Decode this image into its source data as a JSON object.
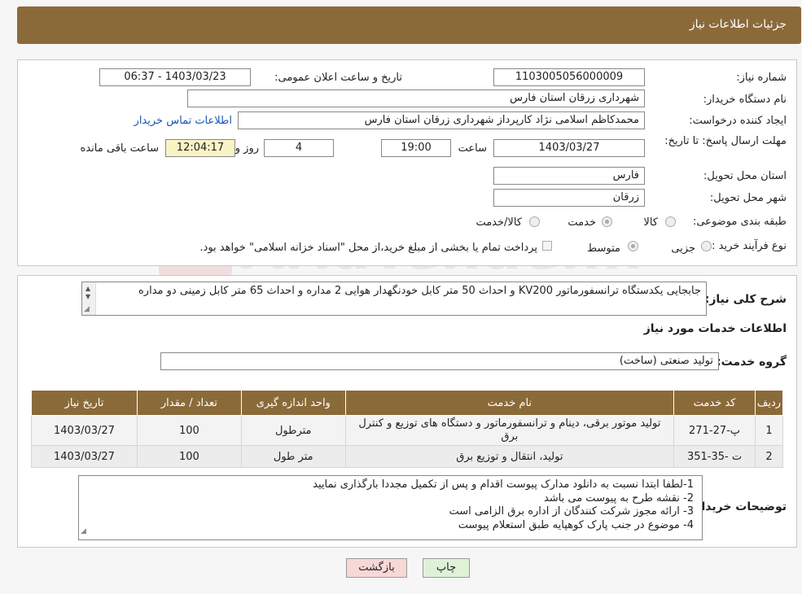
{
  "header": {
    "title": "جزئیات اطلاعات نیاز"
  },
  "form": {
    "need_number_label": "شماره نیاز:",
    "need_number": "1103005056000009",
    "announce_label": "تاریخ و ساعت اعلان عمومی:",
    "announce_value": "1403/03/23 - 06:37",
    "buyer_label": "نام دستگاه خریدار:",
    "buyer_value": "شهرداری زرقان استان فارس",
    "creator_label": "ایجاد کننده درخواست:",
    "creator_value": "محمدکاظم اسلامی نژاد کارپرداز شهرداری زرقان استان فارس",
    "contact_link": "اطلاعات تماس خریدار",
    "deadline_label": "مهلت ارسال پاسخ: تا تاریخ:",
    "deadline_date": "1403/03/27",
    "time_label": "ساعت",
    "deadline_time": "19:00",
    "days_value": "4",
    "days_label": "روز و",
    "remaining_time": "12:04:17",
    "remaining_label": "ساعت باقی مانده",
    "province_label": "استان محل تحویل:",
    "province_value": "فارس",
    "city_label": "شهر محل تحویل:",
    "city_value": "زرقان",
    "category_label": "طبقه بندی موضوعی:",
    "category_options": [
      "کالا",
      "خدمت",
      "کالا/خدمت"
    ],
    "category_selected": "خدمت",
    "process_label": "نوع فرآیند خرید :",
    "process_options": [
      "جزیی",
      "متوسط"
    ],
    "process_selected": "متوسط",
    "payment_note": "پرداخت تمام یا بخشی از مبلغ خرید،از محل \"اسناد خزانه اسلامی\" خواهد بود."
  },
  "summary": {
    "label": "شرح کلی نیاز:",
    "text": "جابجایی یکدستگاه ترانسفورماتور KV200 و احداث 50 متر کابل خودنگهدار هوایی 2 مداره و احداث 65 متر کابل زمینی دو مداره"
  },
  "services": {
    "section_title": "اطلاعات خدمات مورد نیاز",
    "group_label": "گروه خدمت:",
    "group_value": "تولید صنعتی (ساخت)",
    "columns": [
      "ردیف",
      "کد خدمت",
      "نام خدمت",
      "واحد اندازه گیری",
      "تعداد / مقدار",
      "تاریخ نیاز"
    ],
    "rows": [
      {
        "idx": "1",
        "code": "پ-27-271",
        "name": "تولید موتور برقی، دینام و ترانسفورماتور و دستگاه های توزیع و کنترل برق",
        "unit": "مترطول",
        "qty": "100",
        "date": "1403/03/27"
      },
      {
        "idx": "2",
        "code": "ت -35-351",
        "name": "تولید، انتقال و توزیع برق",
        "unit": "متر طول",
        "qty": "100",
        "date": "1403/03/27"
      }
    ]
  },
  "buyer_notes": {
    "label": "توضیحات خریدار:",
    "lines": [
      "1-لطفا ابتدا نسبت به دانلود مدارک پیوست اقدام و پس از تکمیل مجددا بارگذاری نمایید",
      "2- نقشه طرح به پیوست می باشد",
      "3- ارائه مجوز شرکت کنندگان از اداره برق الزامی است",
      "4- موضوع  در جنب پارک کوهپایه طبق استعلام پیوست"
    ]
  },
  "buttons": {
    "print": "چاپ",
    "back": "بازگشت"
  },
  "colors": {
    "header_bg": "#8b6a3a",
    "link": "#1a55b5",
    "back_button_bg": "#f8d7d7",
    "print_button_bg": "#dff2d8"
  }
}
